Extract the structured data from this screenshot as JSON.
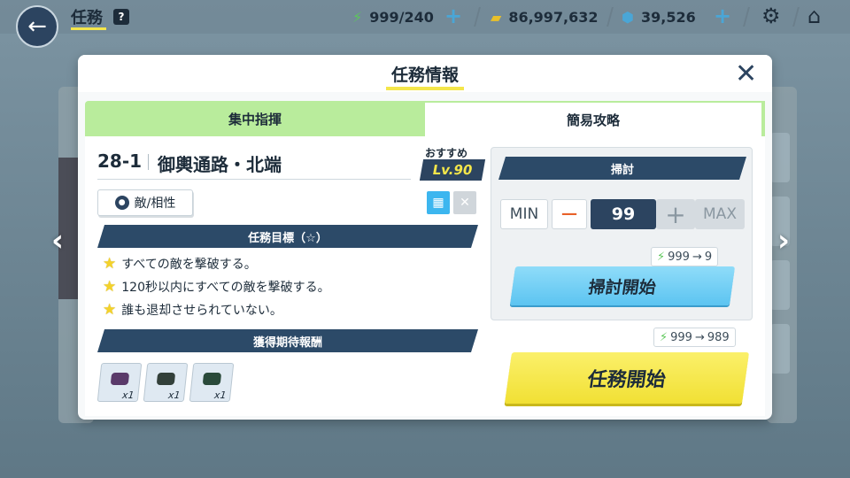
{
  "topbar": {
    "title": "任務",
    "help": "?",
    "stamina": "999/240",
    "credits": "86,997,632",
    "gems": "39,526"
  },
  "modal": {
    "title": "任務情報",
    "tabs": [
      {
        "label": "集中指揮",
        "active": true
      },
      {
        "label": "簡易攻略",
        "active": false
      }
    ],
    "stage": {
      "id": "28-1",
      "name": "御輿通路・北端",
      "recommend_label": "おすすめ",
      "recommend_level": "Lv.90",
      "enemy_button": "敵/相性"
    },
    "goals_title": "任務目標（☆）",
    "goals": [
      "すべての敵を撃破する。",
      "120秒以内にすべての敵を撃破する。",
      "誰も退却させられていない。"
    ],
    "rewards_title": "獲得期待報酬",
    "rewards": [
      {
        "qty": "x1"
      },
      {
        "qty": "x1"
      },
      {
        "qty": "x1"
      }
    ],
    "sweep": {
      "title": "掃討",
      "min_label": "MIN",
      "minus": "−",
      "count": "99",
      "plus": "+",
      "max_label": "MAX",
      "cost_from": "999",
      "cost_arrow": "→",
      "cost_to": "9",
      "start_label": "掃討開始"
    },
    "mission_start": {
      "cost_from": "999",
      "cost_arrow": "→",
      "cost_to": "989",
      "label": "任務開始"
    }
  },
  "colors": {
    "accent_yellow": "#f4e64a",
    "navy": "#2c4460",
    "tab_green": "#b9ec9c",
    "sweep_blue": "#5cc4f1",
    "start_yellow": "#f1e034"
  }
}
